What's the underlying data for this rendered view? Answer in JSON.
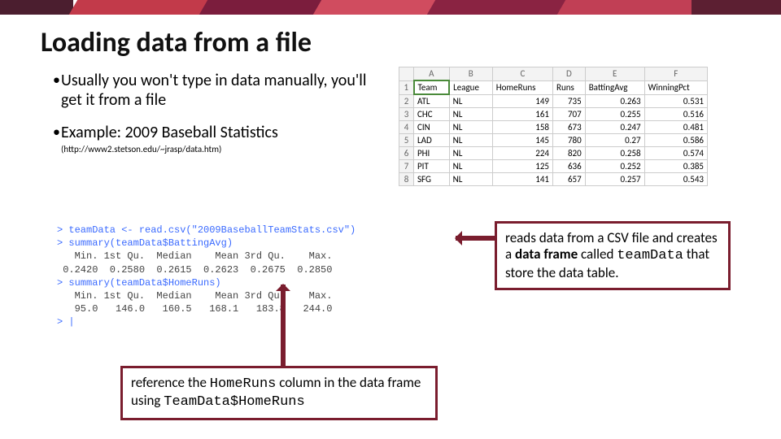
{
  "title": "Loading data from a file",
  "bullets": {
    "b1": "Usually you won't type in data manually, you'll get it from a file",
    "b2": "Example: 2009 Baseball Statistics",
    "b2_note": "(http://www2.stetson.edu/~jrasp/data.htm)"
  },
  "sheet": {
    "cols": [
      "",
      "A",
      "B",
      "C",
      "D",
      "E",
      "F"
    ],
    "header": [
      "Team",
      "League",
      "HomeRuns",
      "Runs",
      "BattingAvg",
      "WinningPct"
    ],
    "rows": [
      [
        "ATL",
        "NL",
        "149",
        "735",
        "0.263",
        "0.531"
      ],
      [
        "CHC",
        "NL",
        "161",
        "707",
        "0.255",
        "0.516"
      ],
      [
        "CIN",
        "NL",
        "158",
        "673",
        "0.247",
        "0.481"
      ],
      [
        "LAD",
        "NL",
        "145",
        "780",
        "0.27",
        "0.586"
      ],
      [
        "PHI",
        "NL",
        "224",
        "820",
        "0.258",
        "0.574"
      ],
      [
        "PIT",
        "NL",
        "125",
        "636",
        "0.252",
        "0.385"
      ],
      [
        "SFG",
        "NL",
        "141",
        "657",
        "0.257",
        "0.543"
      ]
    ]
  },
  "rconsole": {
    "l1": "> teamData <- read.csv(\"2009BaseballTeamStats.csv\")",
    "l2": "> summary(teamData$BattingAvg)",
    "l3": "   Min. 1st Qu.  Median    Mean 3rd Qu.    Max.",
    "l4": " 0.2420  0.2580  0.2615  0.2623  0.2675  0.2850",
    "l5": "> summary(teamData$HomeRuns)",
    "l6": "   Min. 1st Qu.  Median    Mean 3rd Qu.    Max.",
    "l7": "   95.0   146.0   160.5   168.1   183.8   244.0",
    "l8": "> |"
  },
  "callouts": {
    "right_p1": "reads data from a CSV file and creates a ",
    "right_b1": "data frame",
    "right_p2": " called ",
    "right_code": "teamData",
    "right_p3": " that store the data table.",
    "bottom_p1": "reference the ",
    "bottom_code1": "HomeRuns",
    "bottom_p2": " column in the data frame using ",
    "bottom_code2": "TeamData$HomeRuns"
  }
}
